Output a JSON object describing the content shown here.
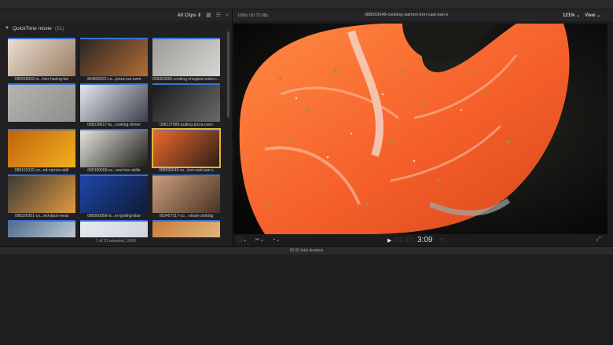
{
  "browser": {
    "filter_label": "All Clips ⇕",
    "event_title": "QuickTime movie",
    "event_count": "(31)",
    "footer": "1 of 31 selected, 10:00",
    "clips": [
      {
        "label": "086558563-m...hter-having-fun",
        "colors": [
          "#e9dfd2",
          "#9a7b62"
        ],
        "selected": false
      },
      {
        "label": "084805822-co...pizza-out-oven",
        "colors": [
          "#2b2622",
          "#b16d37"
        ],
        "selected": false
      },
      {
        "label": "096083656-cooking-chopped-onion-r...",
        "colors": [
          "#9d9b97",
          "#d8d6d2"
        ],
        "selected": false
      },
      {
        "label": "",
        "colors": [
          "#b7b5b2",
          "#8f8d89"
        ],
        "selected": false
      },
      {
        "label": "088228617-fa...cooking-dinner",
        "colors": [
          "#e6e9ee",
          "#3a3f4c"
        ],
        "selected": false
      },
      {
        "label": "088137589-putting-pizza-oven",
        "colors": [
          "#1a1a1a",
          "#6a6a68"
        ],
        "selected": false
      },
      {
        "label": "088101032-co...nd-carrots-skill",
        "colors": [
          "#c0620e",
          "#f2b21c"
        ],
        "selected": false
      },
      {
        "label": "089100069-co...ned-iron-skille",
        "colors": [
          "#e7e5df",
          "#1d1c1a"
        ],
        "selected": false
      },
      {
        "label": "088093649-co...iron-cast-pan-s",
        "colors": [
          "#f06a2c",
          "#2b1e17"
        ],
        "selected": true
      },
      {
        "label": "086326301-co...ted-duck-meat",
        "colors": [
          "#3c3a38",
          "#e19a3e"
        ],
        "selected": false
      },
      {
        "label": "086560058-st...er-igniting-blue",
        "colors": [
          "#1d47a8",
          "#0f1a37"
        ],
        "selected": false
      },
      {
        "label": "083457317-co...-steak-cooking",
        "colors": [
          "#c9a07f",
          "#4a3224"
        ],
        "selected": false
      },
      {
        "label": "",
        "colors": [
          "#4f6d8c",
          "#d7dfe6"
        ],
        "selected": false
      },
      {
        "label": "",
        "colors": [
          "#e8eaf0",
          "#c9ced8"
        ],
        "selected": false
      },
      {
        "label": "",
        "colors": [
          "#c87d3a",
          "#e9c38f"
        ],
        "selected": false
      }
    ]
  },
  "viewer": {
    "format": "1080p HD 23.98p",
    "title": "088093649-cooking-salmon-iron-cast-pan-s",
    "zoom": "121% ⌄",
    "view_menu": "View ⌄",
    "timecode": "3:09"
  },
  "status": {
    "total_duration": "00:00 total duration"
  }
}
